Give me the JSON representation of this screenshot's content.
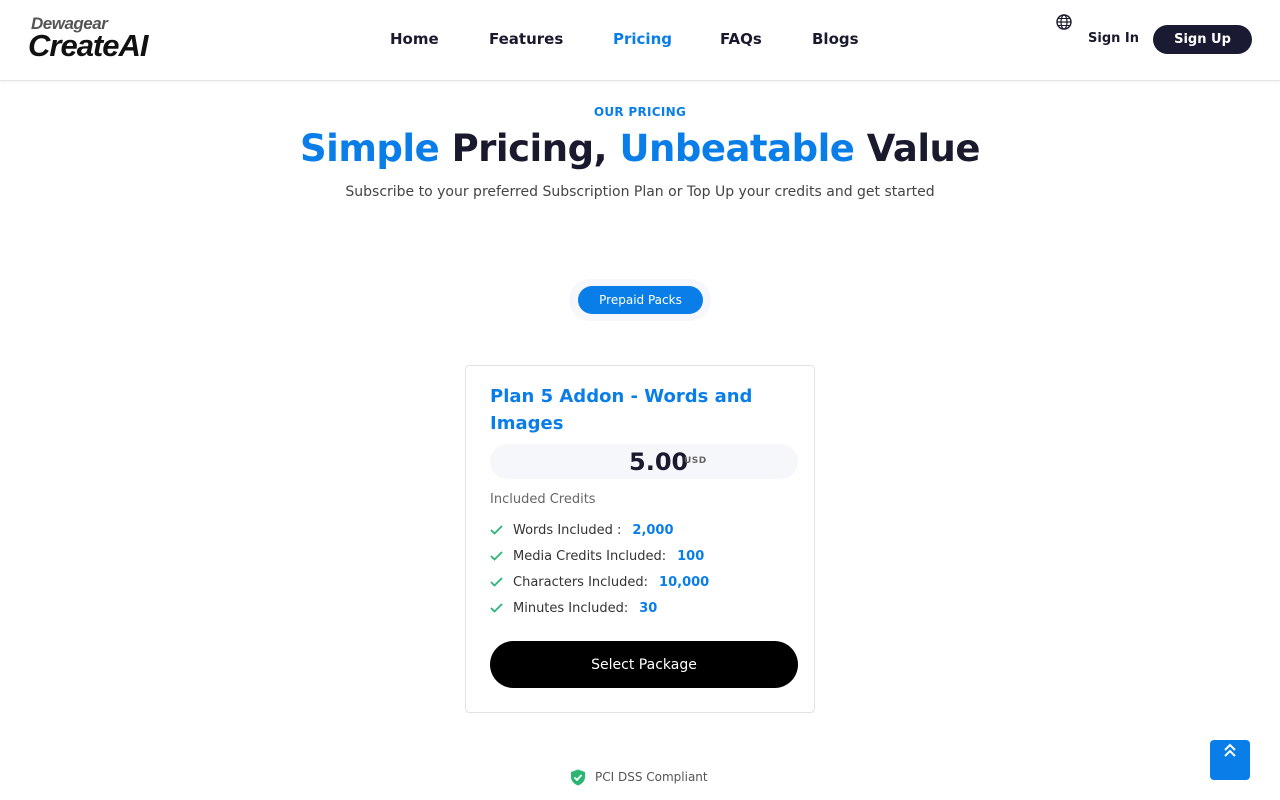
{
  "brand": {
    "top": "Dewagear",
    "bottom": "CreateAI"
  },
  "nav": {
    "items": [
      {
        "label": "Home"
      },
      {
        "label": "Features"
      },
      {
        "label": "Pricing",
        "active": true
      },
      {
        "label": "FAQs"
      },
      {
        "label": "Blogs"
      }
    ],
    "sign_in": "Sign In",
    "sign_up": "Sign Up"
  },
  "hero": {
    "eyebrow": "OUR PRICING",
    "title_parts": [
      "Simple",
      " Pricing, ",
      "Unbeatable",
      " Value"
    ],
    "subtitle": "Subscribe to your preferred Subscription Plan or Top Up your credits and get started"
  },
  "tabs": {
    "active": "Prepaid Packs"
  },
  "plan": {
    "name": "Plan 5 Addon - Words and Images",
    "price": "5.00",
    "currency": "USD",
    "included_label": "Included Credits",
    "features": [
      {
        "label": "Words Included :",
        "value": "2,000"
      },
      {
        "label": "Media Credits Included:",
        "value": "100"
      },
      {
        "label": "Characters Included:",
        "value": "10,000"
      },
      {
        "label": "Minutes Included:",
        "value": "30"
      }
    ],
    "cta": "Select Package"
  },
  "footer": {
    "compliance": "PCI DSS Compliant"
  },
  "colors": {
    "accent": "#0a7ee8",
    "dark": "#1b1a33",
    "check": "#2bb673"
  }
}
